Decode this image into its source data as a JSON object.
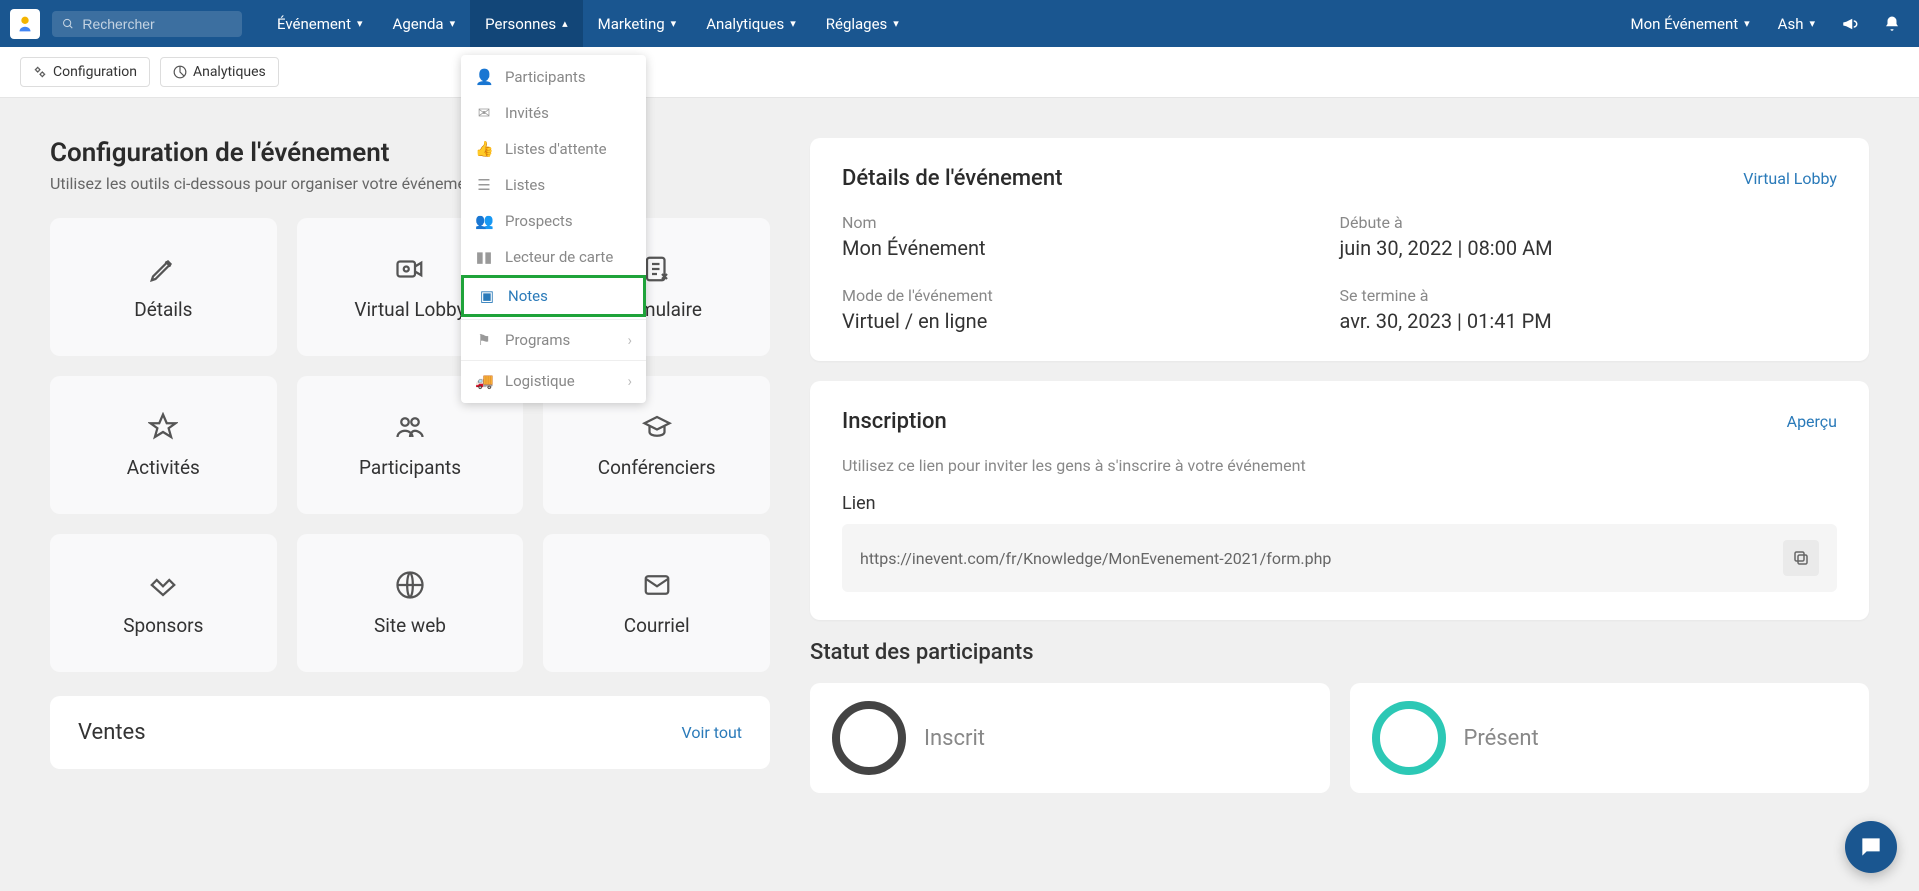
{
  "topbar": {
    "search_placeholder": "Rechercher",
    "menu": [
      "Événement",
      "Agenda",
      "Personnes",
      "Marketing",
      "Analytiques",
      "Réglages"
    ],
    "active_menu_index": 2,
    "event_name": "Mon Événement",
    "user_name": "Ash"
  },
  "subbar": {
    "config": "Configuration",
    "analytics": "Analytiques"
  },
  "dropdown": {
    "items": [
      {
        "icon": "user",
        "label": "Participants"
      },
      {
        "icon": "envelope",
        "label": "Invités"
      },
      {
        "icon": "thumbs-up",
        "label": "Listes d'attente"
      },
      {
        "icon": "list",
        "label": "Listes"
      },
      {
        "icon": "users",
        "label": "Prospects"
      },
      {
        "icon": "card",
        "label": "Lecteur de carte"
      },
      {
        "icon": "note",
        "label": "Notes",
        "highlight": true
      },
      {
        "icon": "flag",
        "label": "Programs",
        "sub": true
      },
      {
        "icon": "truck",
        "label": "Logistique",
        "sub": true
      }
    ]
  },
  "config_section": {
    "title": "Configuration de l'événement",
    "subtitle": "Utilisez les outils ci-dessous pour organiser votre événement",
    "tiles": [
      {
        "icon": "pencil",
        "label": "Détails"
      },
      {
        "icon": "camera",
        "label": "Virtual Lobby"
      },
      {
        "icon": "form",
        "label": "Formulaire"
      },
      {
        "icon": "star",
        "label": "Activités"
      },
      {
        "icon": "people",
        "label": "Participants"
      },
      {
        "icon": "grad",
        "label": "Conférenciers"
      },
      {
        "icon": "handshake",
        "label": "Sponsors"
      },
      {
        "icon": "globe",
        "label": "Site web"
      },
      {
        "icon": "mail",
        "label": "Courriel"
      }
    ]
  },
  "details_card": {
    "title": "Détails de l'événement",
    "link": "Virtual Lobby",
    "fields": {
      "name_label": "Nom",
      "name_value": "Mon Événement",
      "start_label": "Débute à",
      "start_value": "juin 30, 2022 | 08:00 AM",
      "mode_label": "Mode de l'événement",
      "mode_value": "Virtuel / en ligne",
      "end_label": "Se termine à",
      "end_value": "avr. 30, 2023 | 01:41 PM"
    }
  },
  "registration_card": {
    "title": "Inscription",
    "link": "Aperçu",
    "subtitle": "Utilisez ce lien pour inviter les gens à s'inscrire à votre événement",
    "link_label": "Lien",
    "url": "https://inevent.com/fr/Knowledge/MonEvenement-2021/form.php"
  },
  "sales_card": {
    "title": "Ventes",
    "view_all": "Voir tout"
  },
  "status_section": {
    "title": "Statut des participants",
    "inscrit": "Inscrit",
    "present": "Présent"
  }
}
